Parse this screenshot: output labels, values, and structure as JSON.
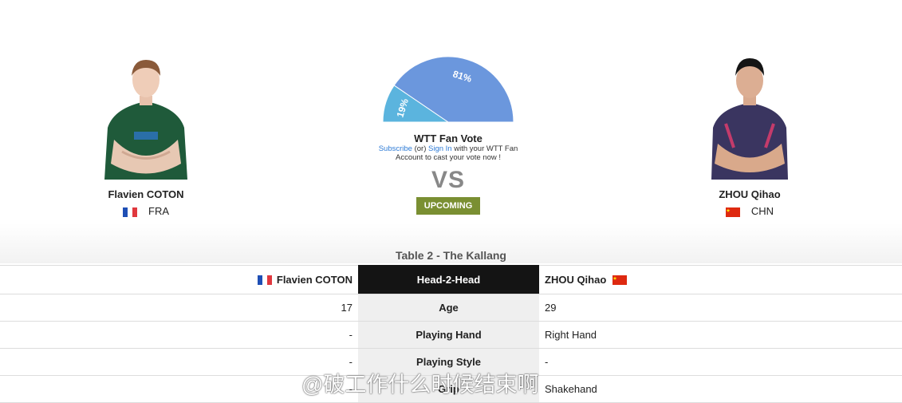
{
  "vote": {
    "chart_data": {
      "type": "pie",
      "subtype": "semi-donut",
      "labels": [
        "Flavien COTON",
        "ZHOU Qihao"
      ],
      "values": [
        19,
        81
      ],
      "data_labels": [
        "19%",
        "81%"
      ],
      "colors": [
        "#5bb4de",
        "#6b97dd"
      ]
    },
    "title": "WTT Fan Vote",
    "subscribe_link": "Subscribe",
    "or_text": " (or) ",
    "signin_link": "Sign In",
    "line1_tail": " with your WTT Fan",
    "line2": "Account to cast your vote now !"
  },
  "vs_label": "VS",
  "status_badge": "UPCOMING",
  "player1": {
    "name": "Flavien COTON",
    "country": "FRA",
    "flag": "france"
  },
  "player2": {
    "name": "ZHOU Qihao",
    "country": "CHN",
    "flag": "china"
  },
  "table_title": "Table 2 - The Kallang",
  "h2h": {
    "header": {
      "left": "Flavien COTON",
      "mid": "Head-2-Head",
      "right": "ZHOU Qihao"
    },
    "rows": [
      {
        "left": "17",
        "label": "Age",
        "right": "29"
      },
      {
        "left": "-",
        "label": "Playing Hand",
        "right": "Right Hand"
      },
      {
        "left": "-",
        "label": "Playing Style",
        "right": "-"
      },
      {
        "left": "-",
        "label": "Grip",
        "right": "Shakehand"
      }
    ]
  },
  "watermark": "@破工作什么时候结束啊",
  "colors": {
    "badge": "#7a8f32",
    "header_dark": "#141414",
    "link": "#2e7bd6"
  }
}
